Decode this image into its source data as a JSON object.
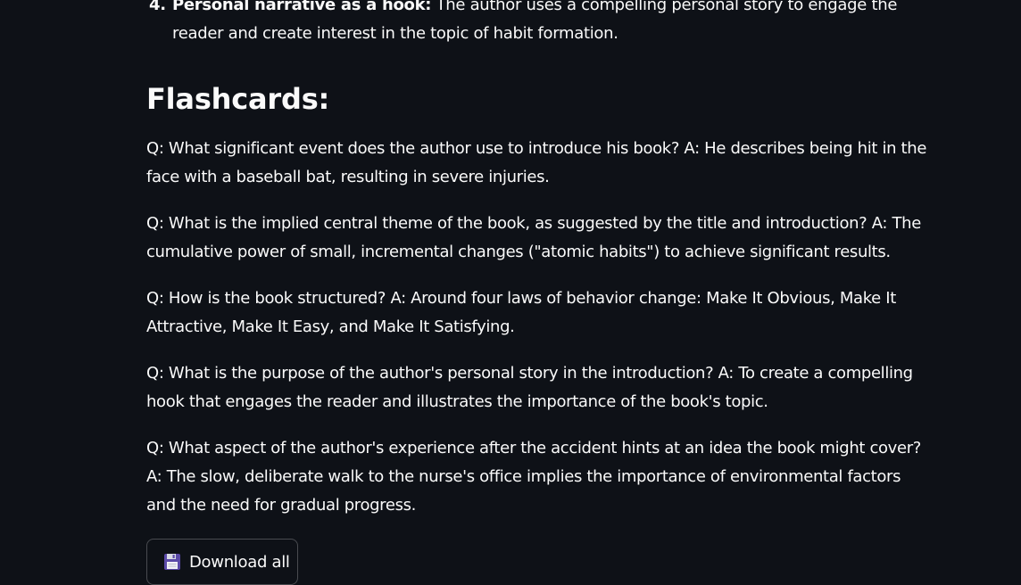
{
  "list": {
    "number": "4.",
    "bold_label": "Personal narrative as a hook:",
    "text": " The author uses a compelling personal story to engage the reader and create interest in the topic of habit formation."
  },
  "flashcards": {
    "heading": "Flashcards:",
    "cards": [
      "Q: What significant event does the author use to introduce his book? A: He describes being hit in the face with a baseball bat, resulting in severe injuries.",
      "Q: What is the implied central theme of the book, as suggested by the title and introduction? A: The cumulative power of small, incremental changes (\"atomic habits\") to achieve significant results.",
      "Q: How is the book structured? A: Around four laws of behavior change: Make It Obvious, Make It Attractive, Make It Easy, and Make It Satisfying.",
      "Q: What is the purpose of the author's personal story in the introduction? A: To create a compelling hook that engages the reader and illustrates the importance of the book's topic.",
      "Q: What aspect of the author's experience after the accident hints at an idea the book might cover? A: The slow, deliberate walk to the nurse's office implies the importance of environmental factors and the need for gradual progress."
    ]
  },
  "download": {
    "label": "Download all",
    "icon": "floppy-disk-icon"
  },
  "colors": {
    "background": "#0e1117",
    "text": "#fafafa",
    "button_border": "rgba(250,250,250,0.25)"
  }
}
